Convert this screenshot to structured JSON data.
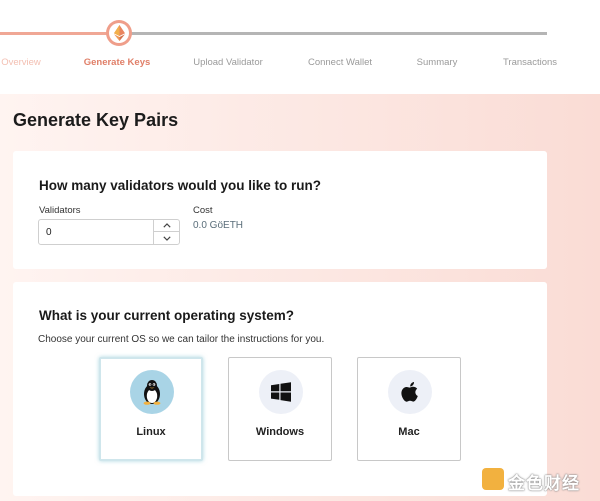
{
  "stepper": {
    "steps": [
      {
        "label": "Overview",
        "state": "done"
      },
      {
        "label": "Generate Keys",
        "state": "active"
      },
      {
        "label": "Upload Validator",
        "state": "todo"
      },
      {
        "label": "Connect Wallet",
        "state": "todo"
      },
      {
        "label": "Summary",
        "state": "todo"
      },
      {
        "label": "Transactions",
        "state": "todo"
      }
    ],
    "current_icon": "ethereum-icon",
    "colors": {
      "done": "#f0a795",
      "active": "#e07f68",
      "todo": "#b5b5b5"
    }
  },
  "page": {
    "title": "Generate Key Pairs"
  },
  "validators_card": {
    "title": "How many validators would you like to run?",
    "validators_label": "Validators",
    "validators_value": "0",
    "cost_label": "Cost",
    "cost_value": "0.0 GöETH"
  },
  "os_card": {
    "title": "What is your current operating system?",
    "description": "Choose your current OS so we can tailor the instructions for you.",
    "options": [
      {
        "label": "Linux",
        "icon": "linux-tux-icon",
        "selected": true
      },
      {
        "label": "Windows",
        "icon": "windows-icon",
        "selected": false
      },
      {
        "label": "Mac",
        "icon": "apple-icon",
        "selected": false
      }
    ]
  },
  "watermark": {
    "text": "金色财经",
    "color": "#f2b13f"
  }
}
